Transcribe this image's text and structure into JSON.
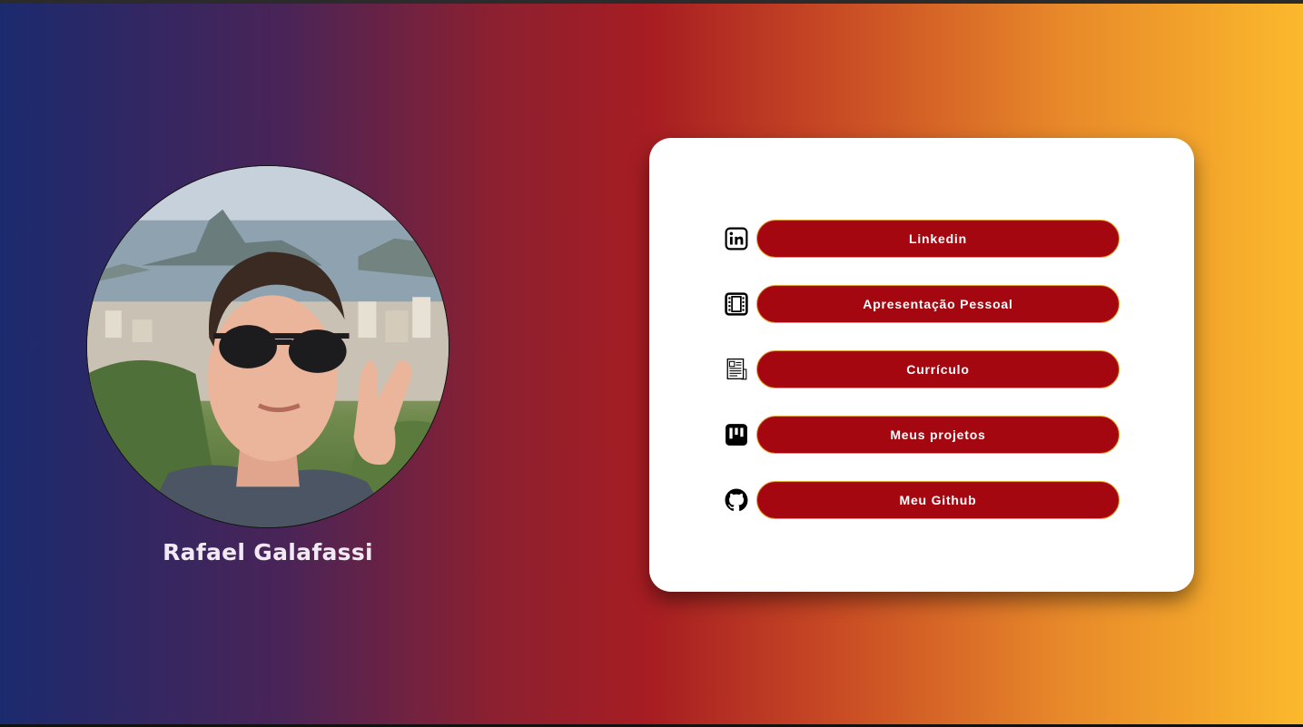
{
  "profile": {
    "name": "Rafael Galafassi"
  },
  "links": [
    {
      "label": "Linkedin",
      "icon": "linkedin-icon"
    },
    {
      "label": "Apresentação Pessoal",
      "icon": "film-icon"
    },
    {
      "label": "Currículo",
      "icon": "document-icon"
    },
    {
      "label": "Meus projetos",
      "icon": "kanban-icon"
    },
    {
      "label": "Meu Github",
      "icon": "github-icon"
    }
  ],
  "colors": {
    "gradient_start": "#1b2a6e",
    "gradient_mid": "#a71d22",
    "gradient_end": "#fbb92c",
    "button_bg": "#a4070f",
    "button_border": "#e6a02a",
    "card_bg": "#ffffff"
  }
}
